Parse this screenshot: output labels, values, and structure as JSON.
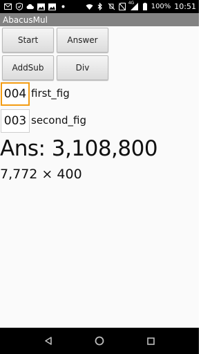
{
  "status_bar": {
    "time": "10:51",
    "battery_percent": "100%",
    "network_badge": "4G",
    "icons": [
      "mail-icon",
      "shield-icon",
      "cloud-icon",
      "image-icon",
      "image-icon",
      "dot-icon",
      "wifi-icon",
      "bluetooth-icon",
      "ring-off-icon",
      "no-sim-icon",
      "signal-icon",
      "battery-icon"
    ]
  },
  "app": {
    "title": "AbacusMul"
  },
  "buttons": {
    "start": "Start",
    "answer": "Answer",
    "addsub": "AddSub",
    "div": "Div"
  },
  "inputs": {
    "first_value": "004",
    "first_label": "first_fig",
    "second_value": "003",
    "second_label": "second_fig"
  },
  "result": {
    "answer": "Ans: 3,108,800",
    "expression": "7,772 × 400"
  },
  "colors": {
    "focus_border": "#f39c12",
    "title_bar": "#828282"
  }
}
